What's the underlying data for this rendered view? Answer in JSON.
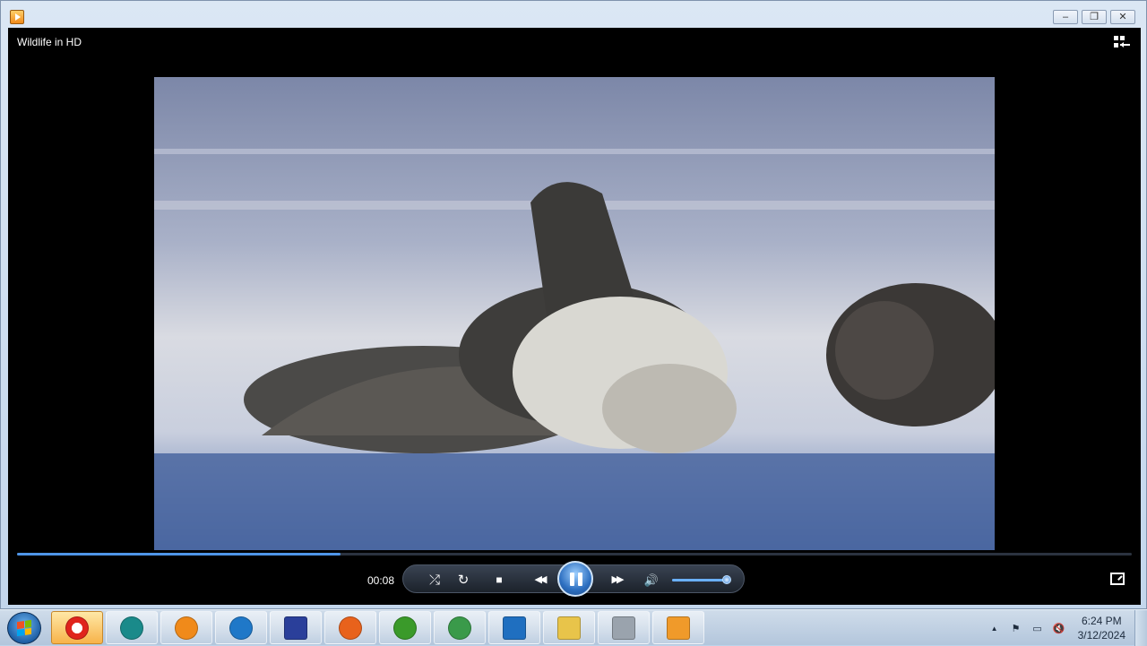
{
  "window": {
    "minimize_glyph": "–",
    "maximize_glyph": "❐",
    "close_glyph": "✕"
  },
  "player": {
    "video_title": "Wildlife in HD",
    "time_elapsed": "00:08",
    "progress_fraction": 0.29,
    "volume_fraction": 0.95,
    "controls": {
      "shuffle_glyph": "⤮",
      "repeat_glyph": "↻",
      "stop_glyph": "■",
      "previous_glyph": "◀◀",
      "next_glyph": "▶▶",
      "mute_glyph": "🔊"
    }
  },
  "taskbar": {
    "items": [
      {
        "name": "opera",
        "color": "#e0241c",
        "active": true
      },
      {
        "name": "globe-app",
        "color": "#1a8a8a",
        "active": false
      },
      {
        "name": "vlc",
        "color": "#f08a1a",
        "active": false
      },
      {
        "name": "edge",
        "color": "#1f78c8",
        "active": false
      },
      {
        "name": "save-disk",
        "color": "#2a3f9a",
        "active": false
      },
      {
        "name": "firefox",
        "color": "#e8621c",
        "active": false
      },
      {
        "name": "windows-app",
        "color": "#3a9a2a",
        "active": false
      },
      {
        "name": "chrome",
        "color": "#3a9a4a",
        "active": false
      },
      {
        "name": "vscode",
        "color": "#1f6fc0",
        "active": false
      },
      {
        "name": "file-explorer",
        "color": "#e8c44a",
        "active": false
      },
      {
        "name": "archive-app",
        "color": "#9aa3ad",
        "active": false
      },
      {
        "name": "media-player",
        "color": "#f09a2a",
        "active": false
      }
    ],
    "tray": {
      "show_hidden_glyph": "▲",
      "flag_glyph": "⚑",
      "network_glyph": "▭",
      "volume_glyph": "🔇"
    },
    "clock_time": "6:24 PM",
    "clock_date": "3/12/2024"
  }
}
